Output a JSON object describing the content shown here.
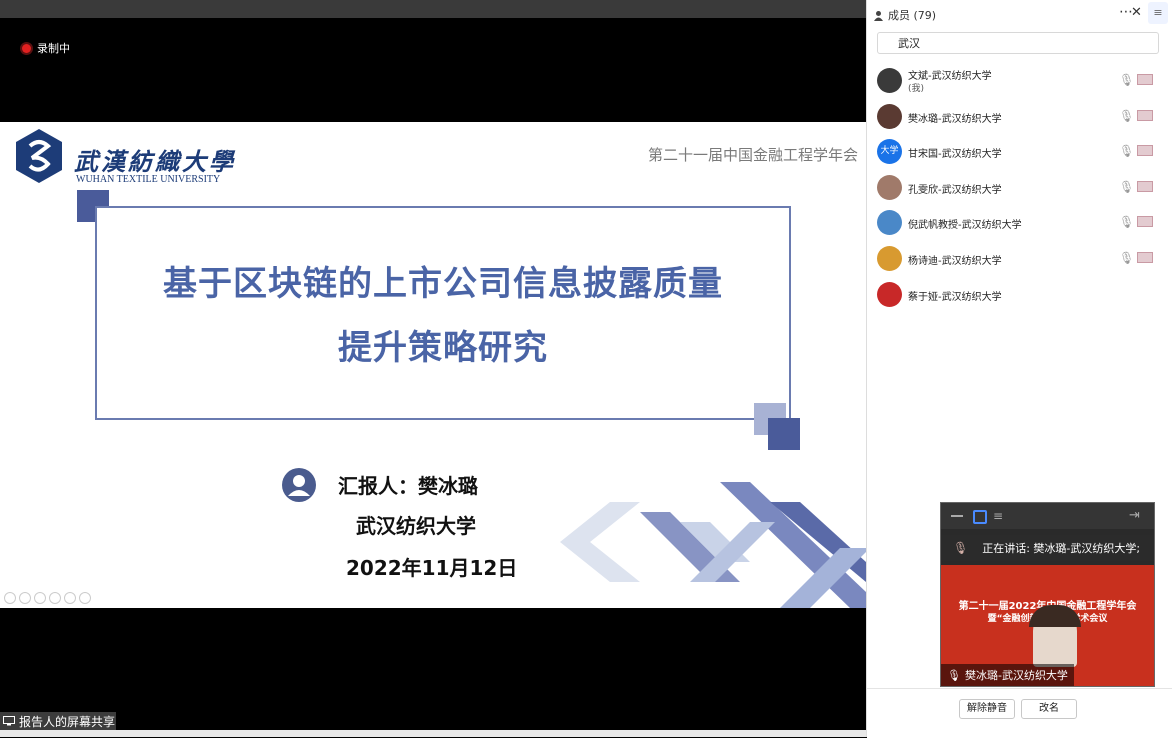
{
  "recording": {
    "label": "录制中"
  },
  "slide": {
    "logo_cn": "武漢紡織大學",
    "logo_en": "WUHAN TEXTILE UNIVERSITY",
    "conference": "第二十一届中国金融工程学年会",
    "title_line1": "基于区块链的上市公司信息披露质量",
    "title_line2": "提升策略研究",
    "reporter": "汇报人：樊冰璐",
    "university": "武汉纺织大学",
    "date": "2022年11月12日"
  },
  "screen_share": {
    "label": "报告人的屏幕共享"
  },
  "panel": {
    "title": "成员 (79)",
    "search": {
      "value": "武汉"
    },
    "members": [
      {
        "name": "文斌-武汉纺织大学",
        "sub": "(我)",
        "avatar_color": "#3a3a3a",
        "mic": true,
        "cam": true
      },
      {
        "name": "樊冰璐-武汉纺织大学",
        "avatar_color": "#5a3a32",
        "mic": true,
        "cam": true
      },
      {
        "name": "甘宋国-武汉纺织大学",
        "avatar_text": "大学",
        "avatar_color": "#1a73e8",
        "mic": true,
        "cam": true
      },
      {
        "name": "孔雯欣-武汉纺织大学",
        "avatar_color": "#a07a6a",
        "mic": true,
        "cam": true
      },
      {
        "name": "倪武帆教授-武汉纺织大学",
        "avatar_color": "#4a88c8",
        "mic": true,
        "cam": true
      },
      {
        "name": "杨诗迪-武汉纺织大学",
        "avatar_color": "#d89a30",
        "mic": true,
        "cam": true
      },
      {
        "name": "蔡于娅-武汉纺织大学",
        "avatar_color": "#c82828",
        "mic": false,
        "cam": false
      }
    ],
    "video": {
      "speaking": "正在讲话: 樊冰璐-武汉纺织大学;",
      "banner_line1": "第二十一届2022年中国金融工程学年会",
      "banner_line2": "暨“金融创新与……”学术会议",
      "name": "樊冰璐-武汉纺织大学"
    },
    "buttons": {
      "unmute_all": "解除静音",
      "rename": "改名"
    }
  }
}
